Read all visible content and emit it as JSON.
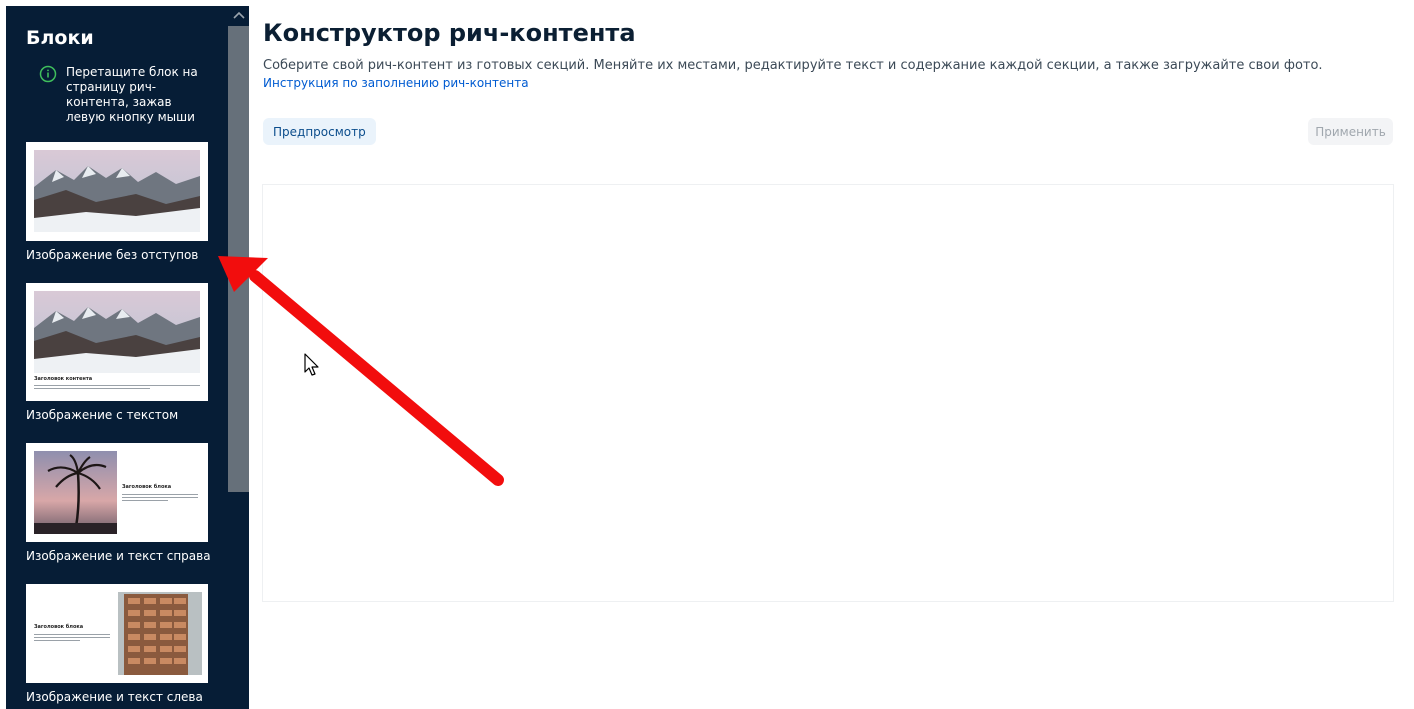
{
  "sidebar": {
    "title": "Блоки",
    "hint": "Перетащите блок на страницу рич-контента, зажав левую кнопку мыши",
    "blocks": [
      {
        "label": "Изображение без отступов"
      },
      {
        "label": "Изображение с текстом",
        "mini_heading": "Заголовок контента"
      },
      {
        "label": "Изображение и текст справа",
        "mini_heading": "Заголовок блока"
      },
      {
        "label": "Изображение и текст слева",
        "mini_heading": "Заголовок блока"
      }
    ]
  },
  "main": {
    "title": "Конструктор рич-контента",
    "description": "Соберите свой рич-контент из готовых секций. Меняйте их местами, редактируйте текст и содержание каждой секции, а также загружайте свои фото.",
    "instruction_link": "Инструкция по заполнению рич-контента",
    "preview_button": "Предпросмотр",
    "apply_button": "Применить"
  },
  "colors": {
    "sidebar_bg": "#061d36",
    "accent_green": "#3fbf5c",
    "link_blue": "#005bd1",
    "annotation_red": "#f20d0d"
  },
  "icons": [
    "info-icon",
    "chevron-up-icon",
    "mouse-cursor-icon"
  ]
}
